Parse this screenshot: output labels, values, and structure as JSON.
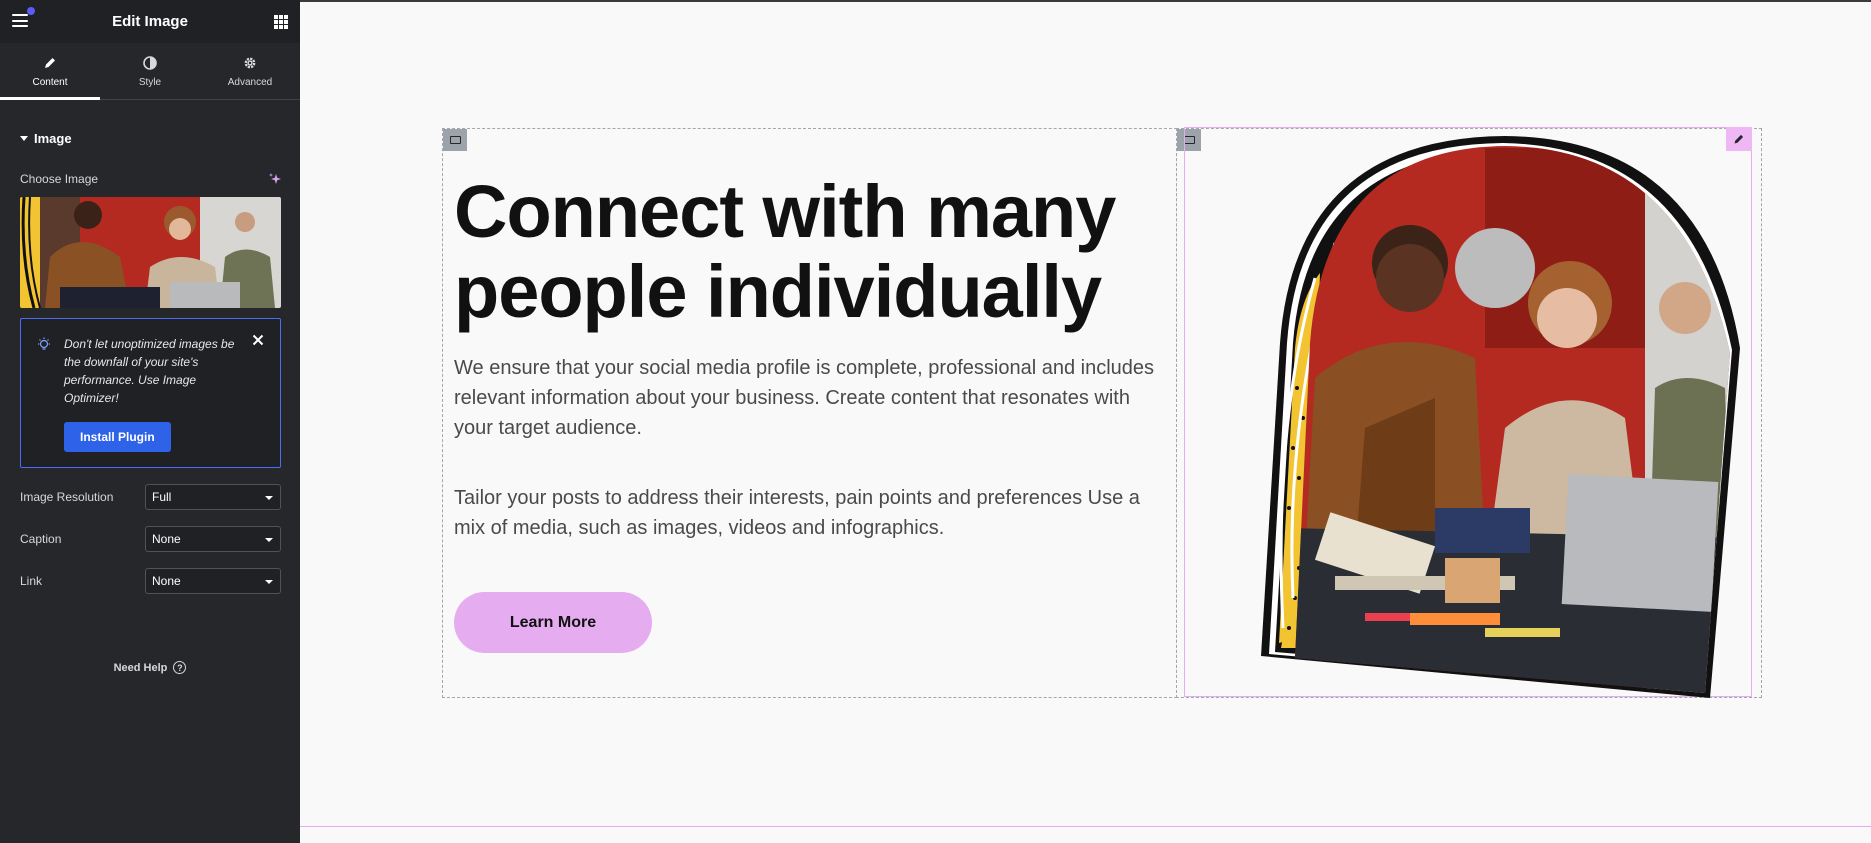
{
  "sidebar": {
    "title": "Edit Image",
    "tabs": [
      {
        "label": "Content",
        "icon": "pencil-icon",
        "active": true
      },
      {
        "label": "Style",
        "icon": "half-circle-icon",
        "active": false
      },
      {
        "label": "Advanced",
        "icon": "gear-icon",
        "active": false
      }
    ],
    "section_title": "Image",
    "choose_image_label": "Choose Image",
    "notice": {
      "message": "Don't let unoptimized images be the downfall of your site's performance. Use Image Optimizer!",
      "button_label": "Install Plugin"
    },
    "fields": [
      {
        "label": "Image Resolution",
        "value": "Full"
      },
      {
        "label": "Caption",
        "value": "None"
      },
      {
        "label": "Link",
        "value": "None"
      }
    ],
    "need_help": "Need Help",
    "accent": "#2e62e8"
  },
  "canvas": {
    "headline": "Connect with many people individually",
    "paragraph1": "We ensure that your social media profile is complete, professional and includes relevant information about your business. Create content that resonates with your target audience.",
    "paragraph2": "Tailor your posts to address their interests, pain points and preferences Use a mix of media, such as images, videos and infographics.",
    "button_label": "Learn More",
    "button_color": "#e5acef"
  }
}
